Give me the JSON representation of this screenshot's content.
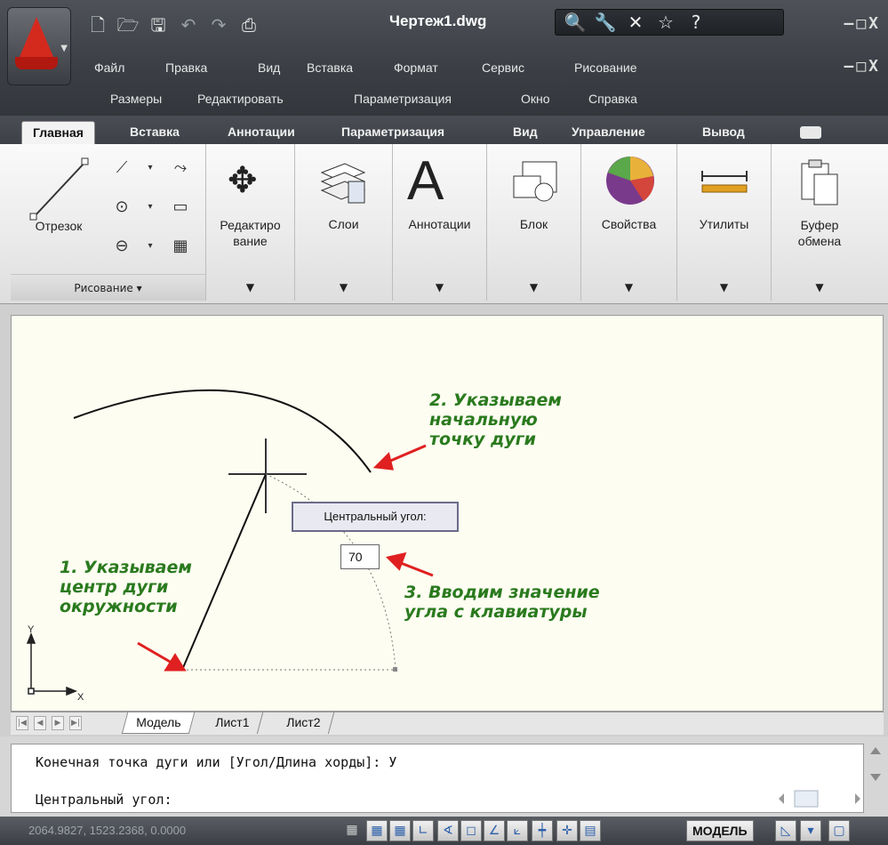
{
  "window": {
    "title": "Чертеж1.dwg"
  },
  "menu_row1": [
    "Файл",
    "Правка",
    "Вид",
    "Вставка",
    "Формат",
    "Сервис",
    "Рисование"
  ],
  "menu_row2": [
    "Размеры",
    "Редактировать",
    "Параметризация",
    "Окно",
    "Справка"
  ],
  "ribbon": {
    "tabs": [
      "Главная",
      "Вставка",
      "Аннотации",
      "Параметризация",
      "Вид",
      "Управление",
      "Вывод"
    ],
    "panels": {
      "draw": {
        "line_label": "Отрезок",
        "footer": "Рисование"
      },
      "modify": {
        "label": "Редактиро\nвание"
      },
      "layers": {
        "label": "Слои"
      },
      "annotation": {
        "label": "Аннотации"
      },
      "block": {
        "label": "Блок"
      },
      "properties": {
        "label": "Свойства"
      },
      "utilities": {
        "label": "Утилиты"
      },
      "clipboard": {
        "label": "Буфер\nобмена"
      }
    }
  },
  "canvas": {
    "notes": {
      "note1": "1. Указываем\nцентр дуги\nокружности",
      "note2": "2. Указываем\nначальную\nточку дуги",
      "note3": "3. Вводим значение\nугла с клавиатуры"
    },
    "tooltip": "Центральный угол:",
    "angle_value": "70",
    "ucs": {
      "x_label": "X",
      "y_label": "Y"
    }
  },
  "layout_tabs": [
    "Модель",
    "Лист1",
    "Лист2"
  ],
  "command": {
    "line1": "Конечная точка дуги или [Угол/Длина хорды]: У",
    "line2": "Центральный угол:"
  },
  "status": {
    "coords": "2064.9827, 1523.2368, 0.0000",
    "model_label": "МОДЕЛЬ"
  }
}
